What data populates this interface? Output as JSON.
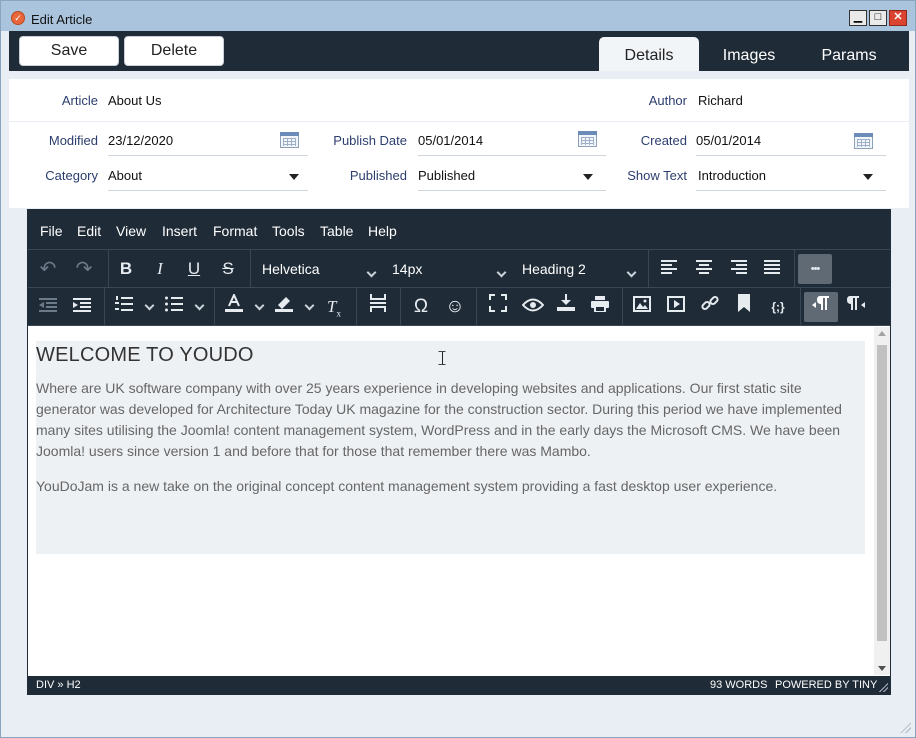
{
  "window": {
    "title": "Edit Article",
    "controls": {
      "minimize": "▁",
      "maximize": "□",
      "close": "✕"
    }
  },
  "toolbar": {
    "save_label": "Save",
    "delete_label": "Delete",
    "tabs": [
      {
        "label": "Details",
        "active": true
      },
      {
        "label": "Images",
        "active": false
      },
      {
        "label": "Params",
        "active": false
      }
    ]
  },
  "form": {
    "article_label": "Article",
    "article_value": "About Us",
    "author_label": "Author",
    "author_value": "Richard",
    "modified_label": "Modified",
    "modified_value": "23/12/2020",
    "publish_date_label": "Publish Date",
    "publish_date_value": "05/01/2014",
    "created_label": "Created",
    "created_value": "05/01/2014",
    "category_label": "Category",
    "category_value": "About",
    "published_label": "Published",
    "published_value": "Published",
    "show_text_label": "Show Text",
    "show_text_value": "Introduction"
  },
  "editor": {
    "menu": [
      "File",
      "Edit",
      "View",
      "Insert",
      "Format",
      "Tools",
      "Table",
      "Help"
    ],
    "font_family": "Helvetica",
    "font_size": "14px",
    "block_format": "Heading 2",
    "icons": {
      "undo": "↶",
      "redo": "↷",
      "bold": "B",
      "italic": "I",
      "underline": "U",
      "strike": "S",
      "more": "•••",
      "special_char": "Ω",
      "emoticon": "☺"
    },
    "content": {
      "heading": "WELCOME TO YOUDO",
      "paragraph1": "Where are UK software company with over 25 years experience in developing websites and applications. Our first static site generator was developed for Architecture Today UK magazine for the construction sector. During this period we have implemented many sites utilising the Joomla! content management system, WordPress and in the early days the Microsoft CMS. We have been Joomla! users since version 1 and before that for those that remember there was Mambo.",
      "paragraph2": "YouDoJam is a new take on the original concept content management system providing a fast desktop user experience."
    },
    "status": {
      "path": "DIV » H2",
      "word_count": "93 WORDS",
      "powered": "POWERED BY TINY"
    }
  },
  "colors": {
    "titlebar": "#aac4dd",
    "dark": "#1f2b37",
    "label": "#2c3e6e",
    "close": "#d9432f"
  }
}
